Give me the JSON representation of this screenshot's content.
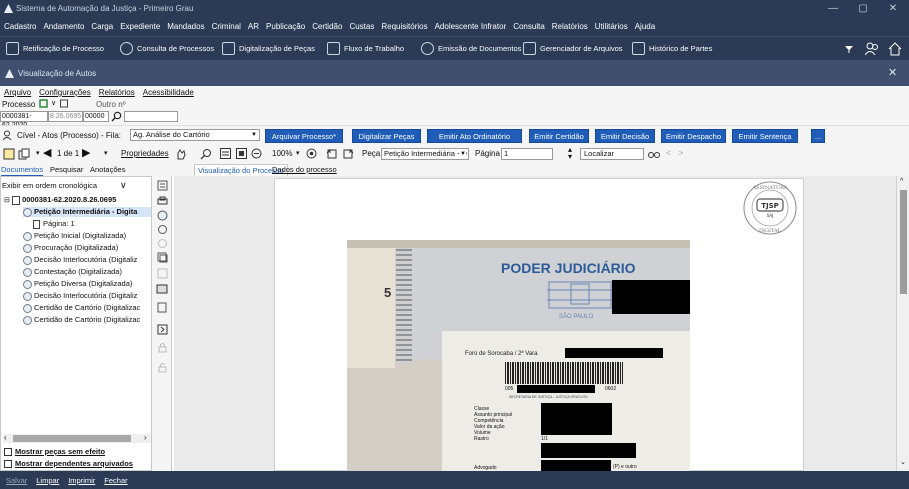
{
  "titlebar": {
    "title": "Sistema de Automação da Justiça - Primeiro Grau",
    "minimize": "—",
    "maximize": "▢",
    "close": "✕"
  },
  "menubar": [
    "Cadastro",
    "Andamento",
    "Carga",
    "Expediente",
    "Mandados",
    "Criminal",
    "AR",
    "Publicação",
    "Certidão",
    "Custas",
    "Requisitórios",
    "Adolescente Infrator",
    "Consulta",
    "Relatórios",
    "Utilitários",
    "Ajuda"
  ],
  "toolbar": {
    "items": [
      "Retificação de Processo",
      "Consulta de Processos",
      "Digitalização de Peças",
      "Fluxo de Trabalho",
      "Emissão de Documentos",
      "Gerenciador de Arquivos",
      "Histórico de Partes"
    ],
    "right_icons": [
      "filter-icon",
      "users-icon",
      "home-icon"
    ]
  },
  "inner": {
    "title": "Visualização de Autos",
    "close": "✕",
    "menu": [
      "Arquivo",
      "Configurações",
      "Relatórios",
      "Acessibilidade"
    ]
  },
  "process": {
    "label": "Processo",
    "other_label": "Outro nº",
    "num1": "0000381-62.2020",
    "num2": "8.26.0695",
    "num3": "00000",
    "other_value": ""
  },
  "civil_row": {
    "text": "Cível - Atos (Processo) - Fila:",
    "fila": "Ag. Análise do Cartório",
    "buttons": [
      "Arquivar Processo*",
      "Digitalizar Peças",
      "Emitir Ato Ordinatório",
      "Emitir Certidão",
      "Emitir Decisão",
      "Emitir Despacho",
      "Emitir Sentença",
      "..."
    ]
  },
  "view_row": {
    "page_of": "1 de 1",
    "propriedades": "Propriedades",
    "zoom": "100%",
    "peca_label": "Peça",
    "peca_value": "Petição Intermediária - D",
    "pagina_label": "Página",
    "pagina_value": "1",
    "localizar": "Localizar"
  },
  "tabs_left": [
    "Documentos",
    "Pesquisar",
    "Anotações"
  ],
  "tabs_right": [
    "Visualização do Processo",
    "Dados do processo"
  ],
  "tree": {
    "order": "Exibir em ordem cronológica",
    "root": "0000381-62.2020.8.26.0695",
    "items": [
      {
        "label": "Petição Intermediária - Digita",
        "selected": true
      },
      {
        "label": "Página: 1"
      },
      {
        "label": "Petição Inicial (Digitalizada)"
      },
      {
        "label": "Procuração (Digitalizada)"
      },
      {
        "label": "Decisão Interlocutória (Digitaliz"
      },
      {
        "label": "Contestação (Digitalizada)"
      },
      {
        "label": "Petição Diversa (Digitalizada)"
      },
      {
        "label": "Decisão Interlocutória (Digitaliz"
      },
      {
        "label": "Certidão de Cartório (Digitalizac"
      },
      {
        "label": "Certidão de Cartório (Digitalizac"
      }
    ],
    "check1": "Mostrar peças sem efeito",
    "check2": "Mostrar dependentes arquivados"
  },
  "document": {
    "stamp_top": "ASSINATURA",
    "stamp_mid": "TJSP",
    "stamp_sub": "SAJ",
    "stamp_bottom": "DIGITAL",
    "heading": "PODER JUDICIÁRIO",
    "city": "SÃO PAULO",
    "page_num": "5",
    "foro": "Foro de Sorocaba / 2ª Vara",
    "barcode_left": "005",
    "barcode_right": "0602",
    "barcode_caption": "SECRETARIA DE JUSTIÇA - JUSTIÇA GRATUITA",
    "fields": [
      "Classe",
      "Assunto principal",
      "Competência",
      "Valor da ação",
      "Volume",
      "Rastro"
    ],
    "volume_val": "1/1",
    "advogado": "Advogado",
    "advogado_tail": "(P) e outro"
  },
  "bottom": [
    "Salvar",
    "Limpar",
    "Imprimir",
    "Fechar"
  ]
}
